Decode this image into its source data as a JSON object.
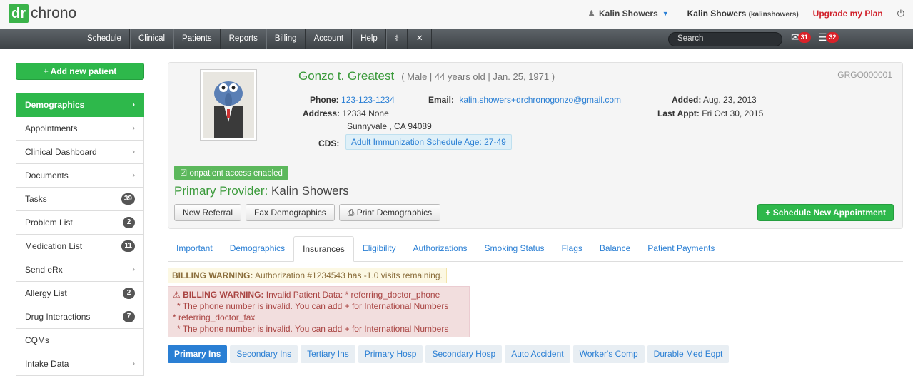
{
  "header": {
    "logo_dr": "dr",
    "logo_chrono": "chrono",
    "user_menu": "Kalin Showers",
    "user_name": "Kalin Showers",
    "user_handle": "(kalinshowers)",
    "upgrade": "Upgrade my Plan"
  },
  "nav": {
    "items": [
      "Schedule",
      "Clinical",
      "Patients",
      "Reports",
      "Billing",
      "Account",
      "Help"
    ],
    "search_placeholder": "Search",
    "messages_count": "31",
    "tasks_count": "32"
  },
  "sidebar": {
    "add_patient": "+ Add new patient",
    "items": [
      {
        "label": "Demographics",
        "count": ""
      },
      {
        "label": "Appointments",
        "count": ""
      },
      {
        "label": "Clinical Dashboard",
        "count": ""
      },
      {
        "label": "Documents",
        "count": ""
      },
      {
        "label": "Tasks",
        "count": "39"
      },
      {
        "label": "Problem List",
        "count": "2"
      },
      {
        "label": "Medication List",
        "count": "11"
      },
      {
        "label": "Send eRx",
        "count": ""
      },
      {
        "label": "Allergy List",
        "count": "2"
      },
      {
        "label": "Drug Interactions",
        "count": "7"
      },
      {
        "label": "CQMs",
        "count": ""
      },
      {
        "label": "Intake Data",
        "count": ""
      }
    ]
  },
  "patient": {
    "name": "Gonzo t. Greatest",
    "details": "( Male | 44 years old | Jan. 25, 1971 )",
    "id": "GRGO000001",
    "phone_label": "Phone:",
    "phone": "123-123-1234",
    "email_label": "Email:",
    "email": "kalin.showers+drchronogonzo@gmail.com",
    "added_label": "Added:",
    "added": "Aug. 23, 2013",
    "address_label": "Address:",
    "address1": "12334 None",
    "address2": "Sunnyvale , CA 94089",
    "last_appt_label": "Last Appt:",
    "last_appt": "Fri Oct 30, 2015",
    "cds_label": "CDS:",
    "cds": "Adult Immunization Schedule Age: 27-49",
    "access": "onpatient access enabled",
    "provider_label": "Primary Provider:",
    "provider": "Kalin Showers",
    "btn_referral": "New Referral",
    "btn_fax": "Fax Demographics",
    "btn_print": "Print Demographics",
    "btn_schedule": "+ Schedule New Appointment"
  },
  "tabs": [
    "Important",
    "Demographics",
    "Insurances",
    "Eligibility",
    "Authorizations",
    "Smoking Status",
    "Flags",
    "Balance",
    "Patient Payments"
  ],
  "warnings": {
    "w1_title": "BILLING WARNING:",
    "w1_text": "Authorization #1234543 has -1.0 visits remaining.",
    "w2_title": "BILLING WARNING:",
    "w2_line1": "Invalid Patient Data: * referring_doctor_phone",
    "w2_line2": "* The phone number is invalid.  You can add + for International Numbers",
    "w2_line3": "* referring_doctor_fax",
    "w2_line4": "* The phone number is invalid.  You can add + for International Numbers"
  },
  "subtabs": [
    "Primary Ins",
    "Secondary Ins",
    "Tertiary Ins",
    "Primary Hosp",
    "Secondary Hosp",
    "Auto Accident",
    "Worker's Comp",
    "Durable Med Eqpt"
  ]
}
